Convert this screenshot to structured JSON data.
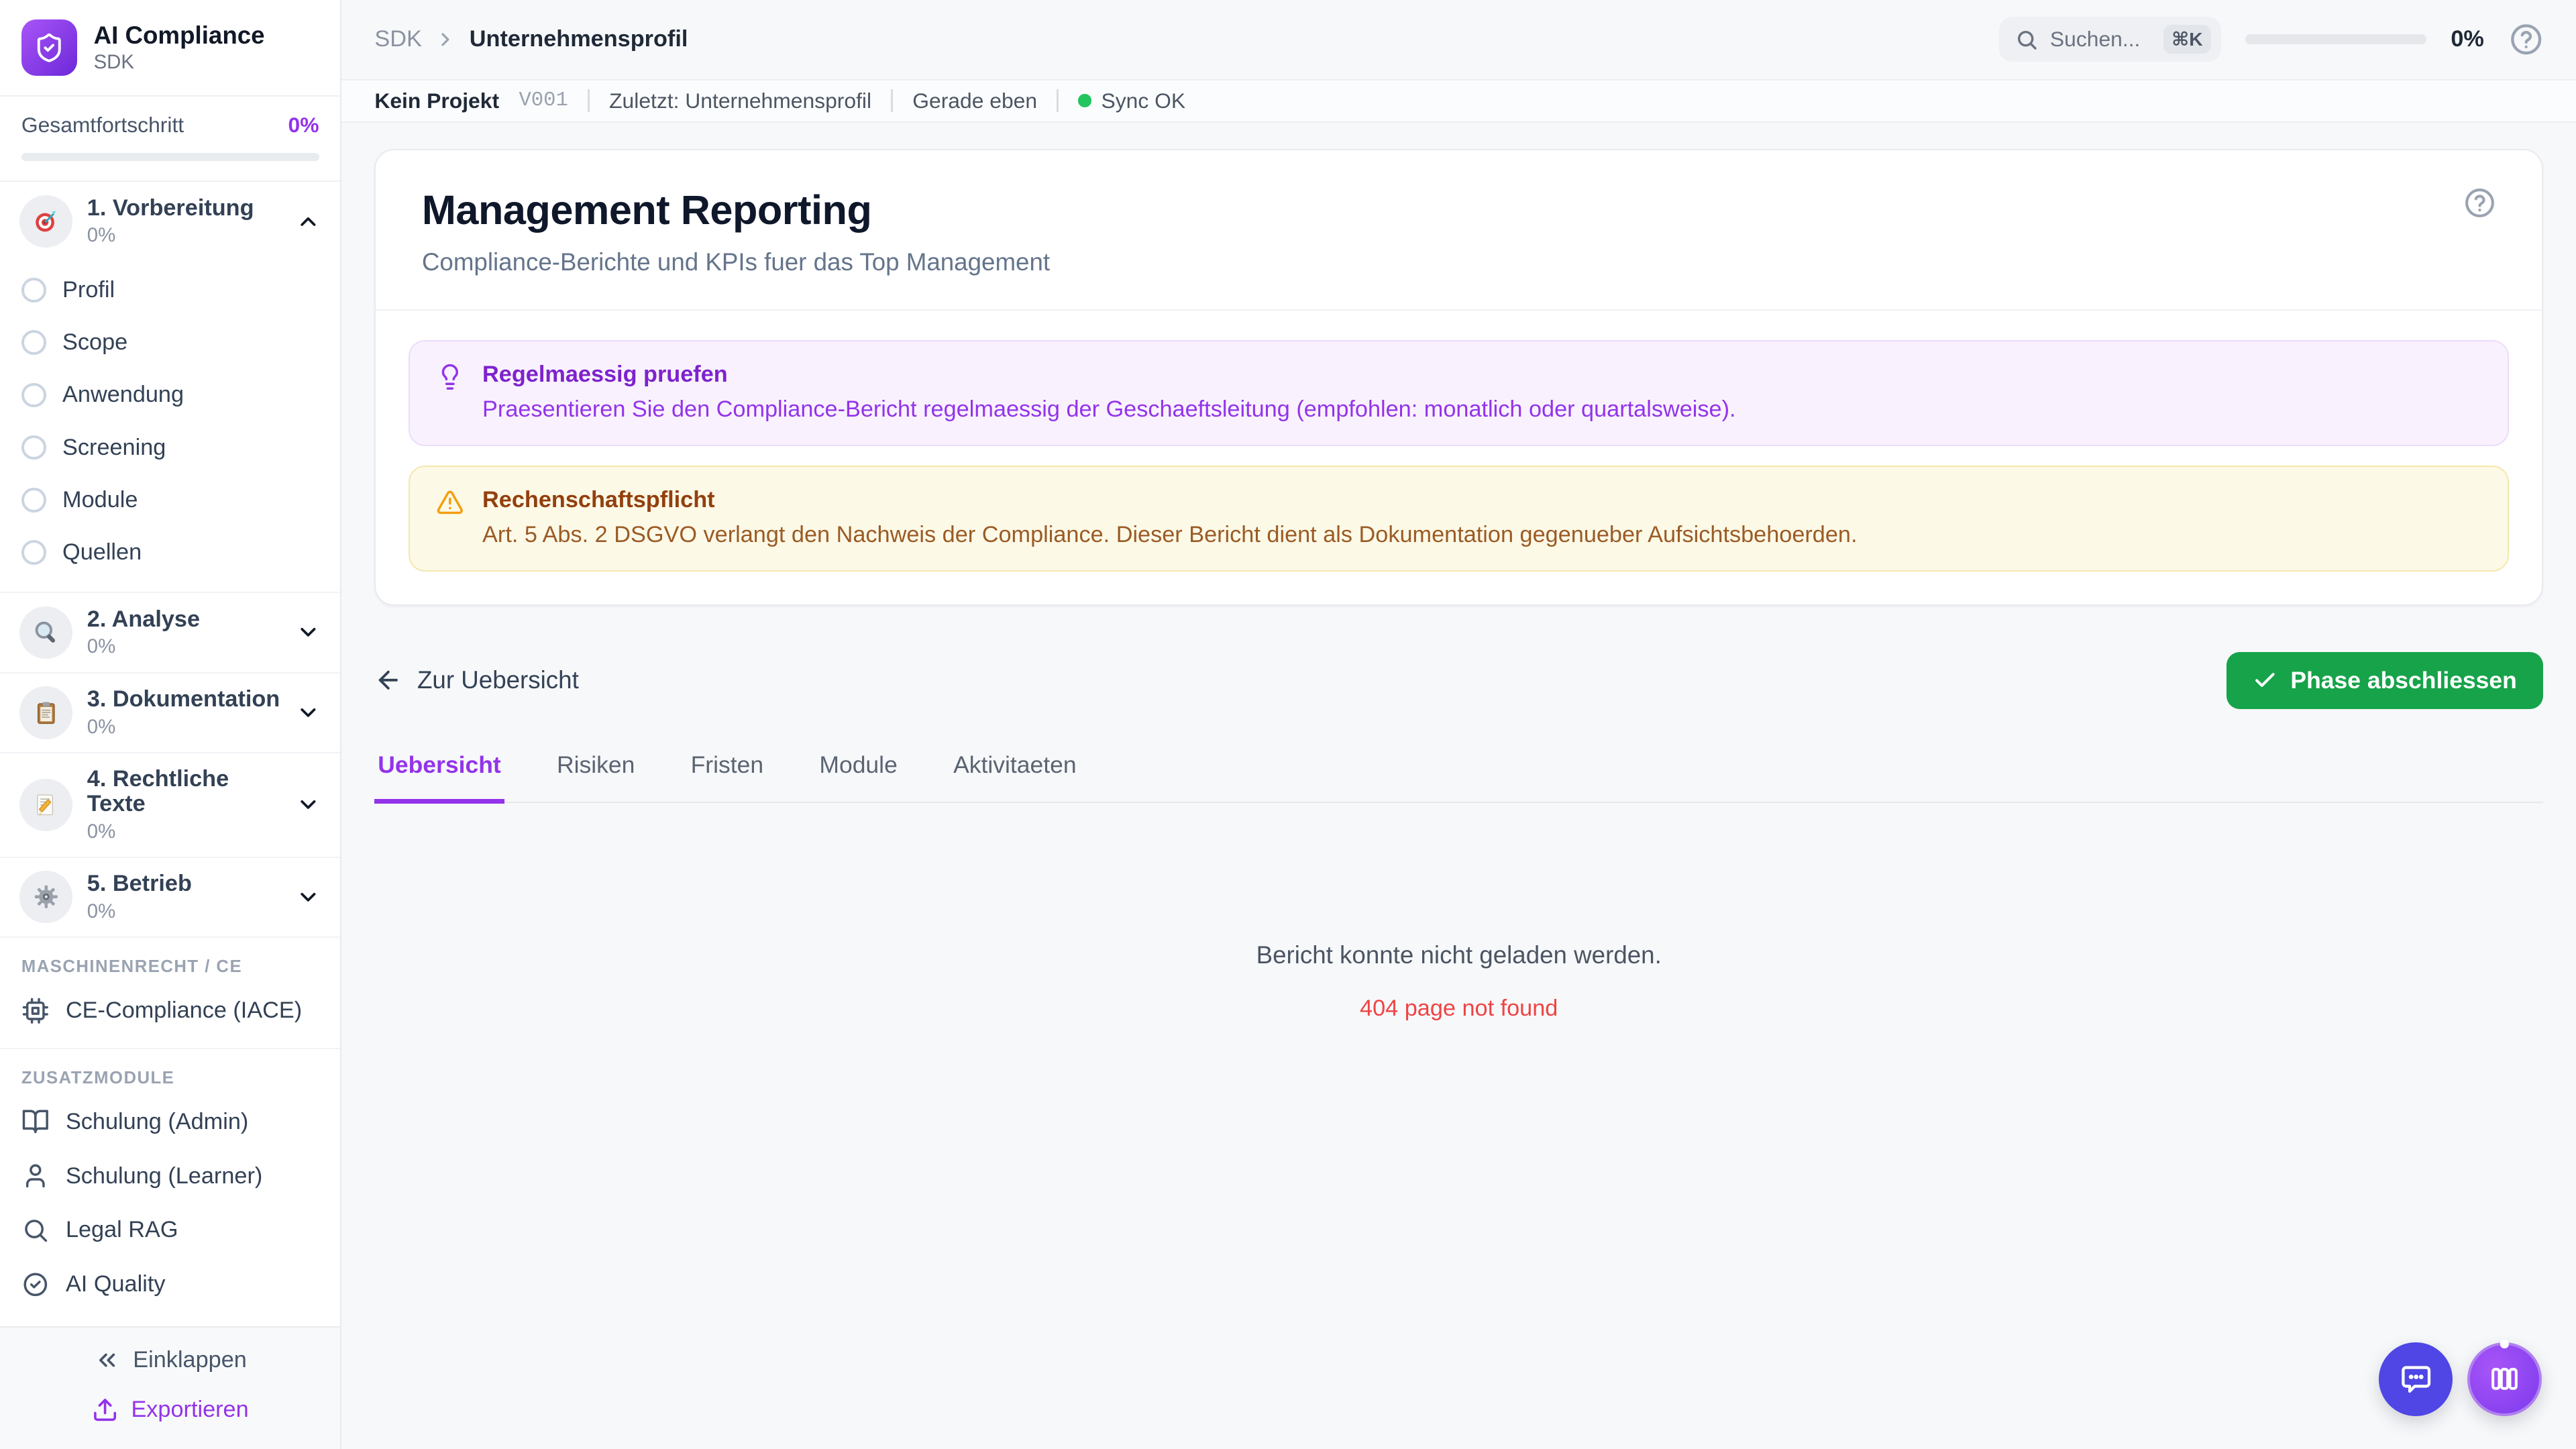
{
  "brand": {
    "name": "AI Compliance",
    "subtitle": "SDK"
  },
  "sidebar": {
    "overall_label": "Gesamtfortschritt",
    "overall_value": "0%",
    "phases": [
      {
        "label": "1. Vorbereitung",
        "percent": "0%",
        "icon": "target-icon"
      },
      {
        "label": "2. Analyse",
        "percent": "0%",
        "icon": "magnifier-icon"
      },
      {
        "label": "3. Dokumentation",
        "percent": "0%",
        "icon": "clipboard-icon"
      },
      {
        "label": "4. Rechtliche Texte",
        "percent": "0%",
        "icon": "memo-icon"
      },
      {
        "label": "5. Betrieb",
        "percent": "0%",
        "icon": "gear-icon"
      }
    ],
    "phase1_items": [
      "Profil",
      "Scope",
      "Anwendung",
      "Screening",
      "Module",
      "Quellen"
    ],
    "section1_label": "MASCHINENRECHT / CE",
    "section1_items": [
      "CE-Compliance (IACE)"
    ],
    "section2_label": "ZUSATZMODULE",
    "section2_items": [
      "Schulung (Admin)",
      "Schulung (Learner)",
      "Legal RAG",
      "AI Quality"
    ],
    "collapse_label": "Einklappen",
    "export_label": "Exportieren"
  },
  "topbar": {
    "breadcrumb": [
      "SDK",
      "Unternehmensprofil"
    ],
    "search_placeholder": "Suchen...",
    "search_shortcut": "⌘K",
    "progress_value": "0%"
  },
  "statusbar": {
    "project": "Kein Projekt",
    "version": "V001",
    "last": "Zuletzt: Unternehmensprofil",
    "time": "Gerade eben",
    "sync": "Sync OK"
  },
  "page": {
    "title": "Management Reporting",
    "subtitle": "Compliance-Berichte und KPIs fuer das Top Management"
  },
  "alerts": [
    {
      "icon": "lightbulb-icon",
      "title": "Regelmaessig pruefen",
      "body": "Praesentieren Sie den Compliance-Bericht regelmaessig der Geschaeftsleitung (empfohlen: monatlich oder quartalsweise)."
    },
    {
      "icon": "warning-triangle-icon",
      "title": "Rechenschaftspflicht",
      "body": "Art. 5 Abs. 2 DSGVO verlangt den Nachweis der Compliance. Dieser Bericht dient als Dokumentation gegenueber Aufsichtsbehoerden."
    }
  ],
  "actions": {
    "back": "Zur Uebersicht",
    "complete": "Phase abschliessen"
  },
  "tabs": [
    "Uebersicht",
    "Risiken",
    "Fristen",
    "Module",
    "Aktivitaeten"
  ],
  "empty": {
    "message": "Bericht konnte nicht geladen werden.",
    "error": "404 page not found"
  },
  "colors": {
    "accent": "#9333ea",
    "green": "#16a34a",
    "red": "#ef4444",
    "sync": "#22c55e"
  }
}
